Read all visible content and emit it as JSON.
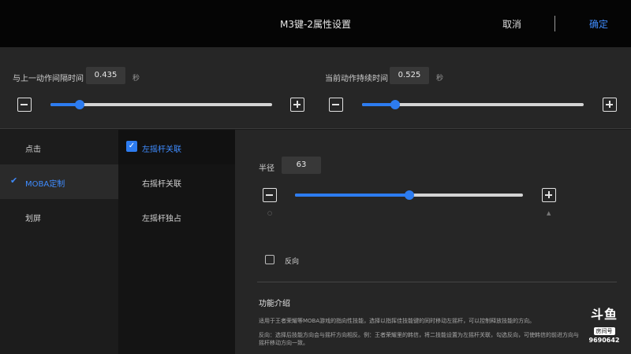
{
  "header": {
    "title": "M3键-2属性设置",
    "cancel_label": "取消",
    "confirm_label": "确定"
  },
  "top_settings": {
    "interval": {
      "label": "与上一动作间隔时间",
      "value": "0.435",
      "unit": "秒",
      "slider_fraction": 0.13
    },
    "duration": {
      "label": "当前动作持续时间",
      "value": "0.525",
      "unit": "秒",
      "slider_fraction": 0.15
    }
  },
  "nav": {
    "items": [
      {
        "label": "点击",
        "active": false
      },
      {
        "label": "MOBA定制",
        "active": true
      },
      {
        "label": "划屏",
        "active": false
      }
    ]
  },
  "subnav": {
    "items": [
      {
        "label": "左摇杆关联",
        "checked": true
      },
      {
        "label": "右摇杆关联",
        "checked": false
      },
      {
        "label": "左摇杆独占",
        "checked": false
      }
    ]
  },
  "main": {
    "radius_label": "半径",
    "radius_value": "63",
    "radius_slider_fraction": 0.5,
    "reverse_label": "反向",
    "intro_title": "功能介绍",
    "intro_text_1": "适用于王者荣耀等MOBA游戏的指向性技能，选择以指挥佳技能键的同时移动左摇杆，可以控制释放技能的方向。",
    "intro_text_2": "反向：选择后技能方向会与摇杆方向相反。例：王者荣耀里的韩信，将二技能设置为左摇杆关联，勾选反向，可使韩信的前进方向与摇杆移动方向一致。"
  },
  "watermark": {
    "logo": "斗鱼",
    "sub": "房间号",
    "room": "9690642"
  },
  "colors": {
    "accent": "#2d7cf0",
    "link": "#3f8cff",
    "background": "#262626",
    "header": "#050505"
  }
}
